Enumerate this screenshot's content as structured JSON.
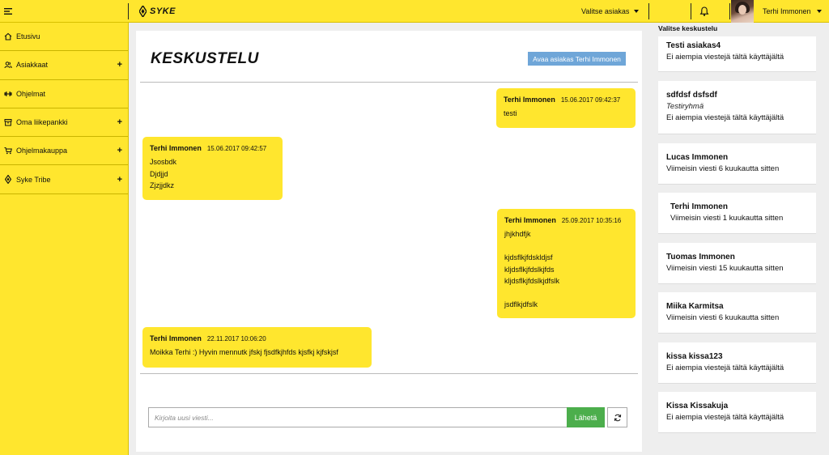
{
  "header": {
    "logo_text": "SYKE",
    "customer_select": "Valitse asiakas",
    "user_name": "Terhi Immonen"
  },
  "sidebar": {
    "items": [
      {
        "label": "Etusivu",
        "icon": "home-icon",
        "expandable": false
      },
      {
        "label": "Asiakkaat",
        "icon": "users-icon",
        "expandable": true
      },
      {
        "label": "Ohjelmat",
        "icon": "dumbbell-icon",
        "expandable": false
      },
      {
        "label": "Oma liikepankki",
        "icon": "archive-icon",
        "expandable": true
      },
      {
        "label": "Ohjelmakauppa",
        "icon": "cart-icon",
        "expandable": true
      },
      {
        "label": "Syke Tribe",
        "icon": "tribe-icon",
        "expandable": true
      }
    ],
    "plus_symbol": "+"
  },
  "main": {
    "title": "KESKUSTELU",
    "open_customer_button": "Avaa asiakas Terhi Immonen",
    "messages": [
      {
        "author": "Terhi Immonen",
        "time": "15.06.2017 09:42:37",
        "lines": [
          "testi"
        ]
      },
      {
        "author": "Terhi Immonen",
        "time": "15.06.2017 09:42:57",
        "lines": [
          "Jsosbdk",
          "Djdjjd",
          "Zjzjjdkz"
        ]
      },
      {
        "author": "Terhi Immonen",
        "time": "25.09.2017 10:35:16",
        "lines": [
          "jhjkhdfjk",
          "",
          "kjdsflkjfdskldjsf",
          "kljdsflkjfdslkjfds",
          "kljdsflkjfdslkjdfslk",
          "",
          "jsdflkjdfslk"
        ]
      },
      {
        "author": "Terhi Immonen",
        "time": "22.11.2017 10:06:20",
        "lines": [
          "Moikka Terhi :) Hyvin mennutk jfskj fjsdfkjhfds kjsfkj kjfskjsf"
        ]
      }
    ],
    "composer_placeholder": "Kirjoita uusi viesti...",
    "send_button": "Lähetä"
  },
  "conversations": {
    "heading": "Valitse keskustelu",
    "items": [
      {
        "name": "Testi asiakas4",
        "sub": "",
        "meta": "Ei aiempia viestejä tältä käyttäjältä"
      },
      {
        "name": "sdfdsf dsfsdf",
        "sub": "Testiryhmä",
        "meta": "Ei aiempia viestejä tältä käyttäjältä"
      },
      {
        "name": "Lucas Immonen",
        "sub": "",
        "meta": "Viimeisin viesti 6 kuukautta sitten"
      },
      {
        "name": "Terhi Immonen",
        "sub": "",
        "meta": "Viimeisin viesti 1 kuukautta sitten"
      },
      {
        "name": "Tuomas Immonen",
        "sub": "",
        "meta": "Viimeisin viesti 15 kuukautta sitten"
      },
      {
        "name": "Miika Karmitsa",
        "sub": "",
        "meta": "Viimeisin viesti 6 kuukautta sitten"
      },
      {
        "name": "kissa kissa123",
        "sub": "",
        "meta": "Ei aiempia viestejä tältä käyttäjältä"
      },
      {
        "name": "Kissa Kissakuja",
        "sub": "",
        "meta": "Ei aiempia viestejä tältä käyttäjältä"
      }
    ]
  },
  "colors": {
    "brand_yellow": "#ffe62e",
    "button_blue": "#6fa6d8",
    "send_green": "#4cae4c"
  }
}
